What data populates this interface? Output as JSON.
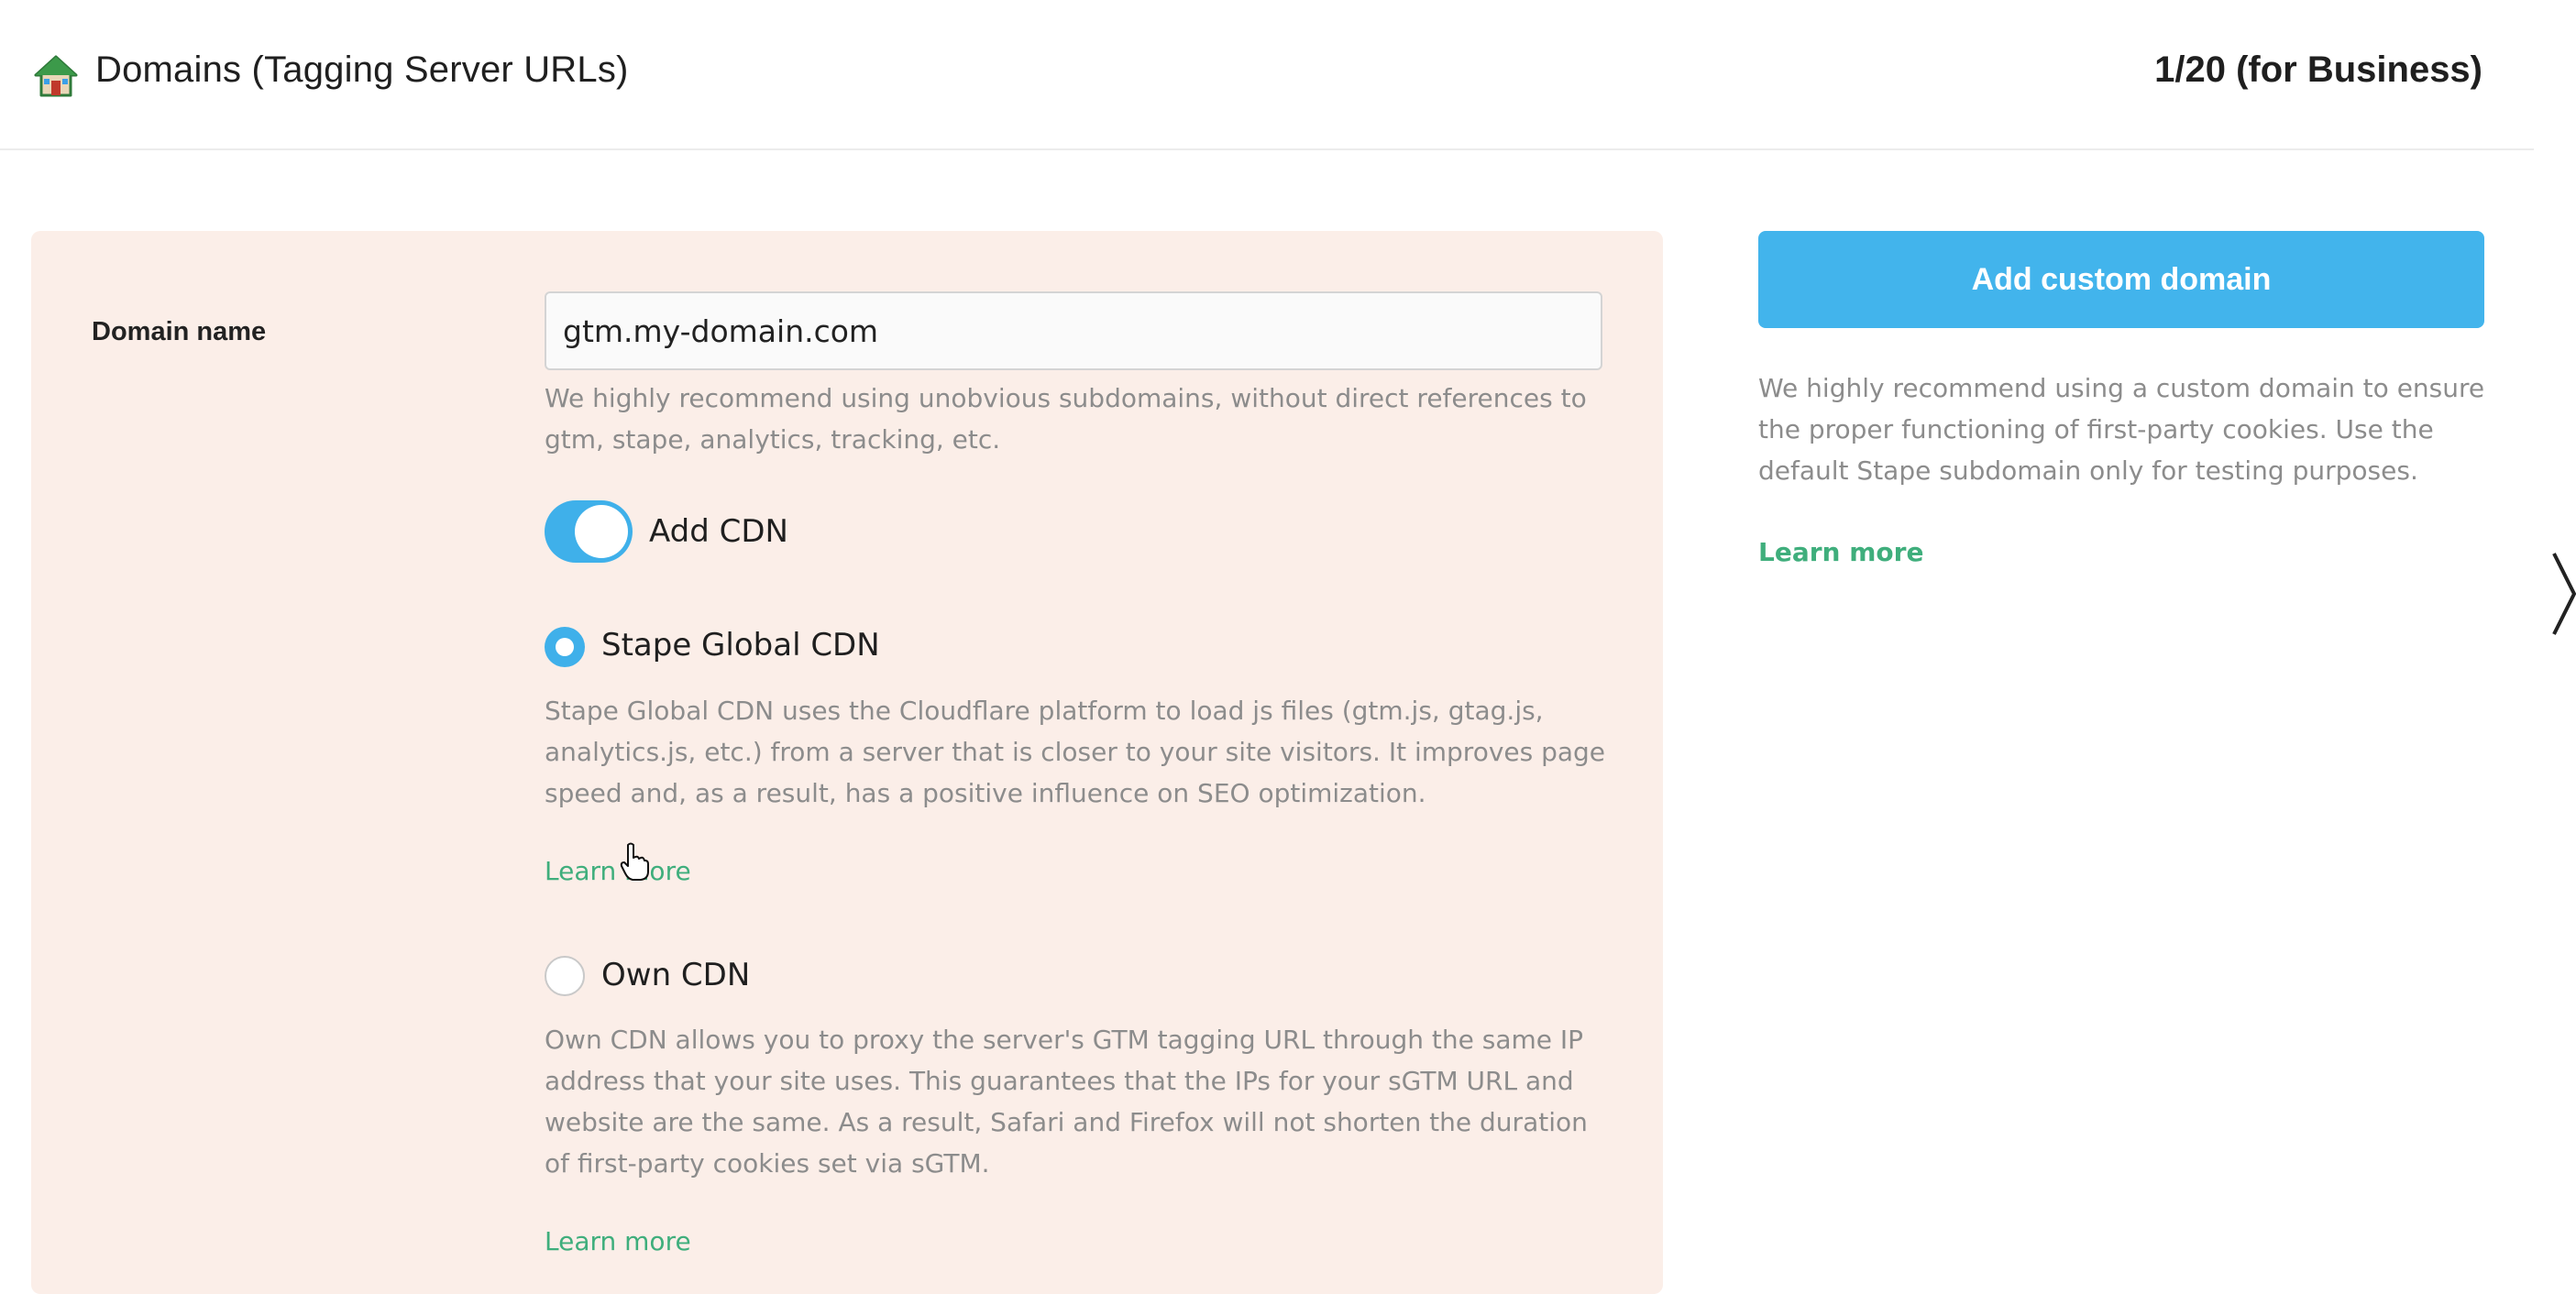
{
  "header": {
    "home_icon": "home-icon",
    "title": "Domains (Tagging Server URLs)",
    "count": "1/20 (for Business)"
  },
  "form": {
    "domain_label": "Domain name",
    "domain_value": "gtm.my-domain.com",
    "domain_help": "We highly recommend using unobvious subdomains, without direct references to gtm, stape, analytics, tracking, etc.",
    "cdn_toggle": {
      "label": "Add CDN",
      "on": true
    },
    "options": [
      {
        "label": "Stape Global CDN",
        "selected": true,
        "description": "Stape Global CDN uses the Cloudflare platform to load js files (gtm.js, gtag.js, analytics.js, etc.) from a server that is closer to your site visitors. It improves page speed and, as a result, has a positive influence on SEO optimization.",
        "link": "Learn more"
      },
      {
        "label": "Own CDN",
        "selected": false,
        "description": "Own CDN allows you to proxy the server's GTM tagging URL through the same IP address that your site uses. This guarantees that the IPs for your sGTM URL and website are the same. As a result, Safari and Firefox will not shorten the duration of first-party cookies set via sGTM.",
        "link": "Learn more"
      }
    ]
  },
  "sidebar": {
    "button_label": "Add custom domain",
    "description": "We highly recommend using a custom domain to ensure the proper functioning of first-party cookies. Use the default Stape subdomain only for testing purposes.",
    "link": "Learn more"
  },
  "colors": {
    "accent": "#42b4ec",
    "link": "#3fae7c",
    "panel_bg": "#fbeee8"
  }
}
